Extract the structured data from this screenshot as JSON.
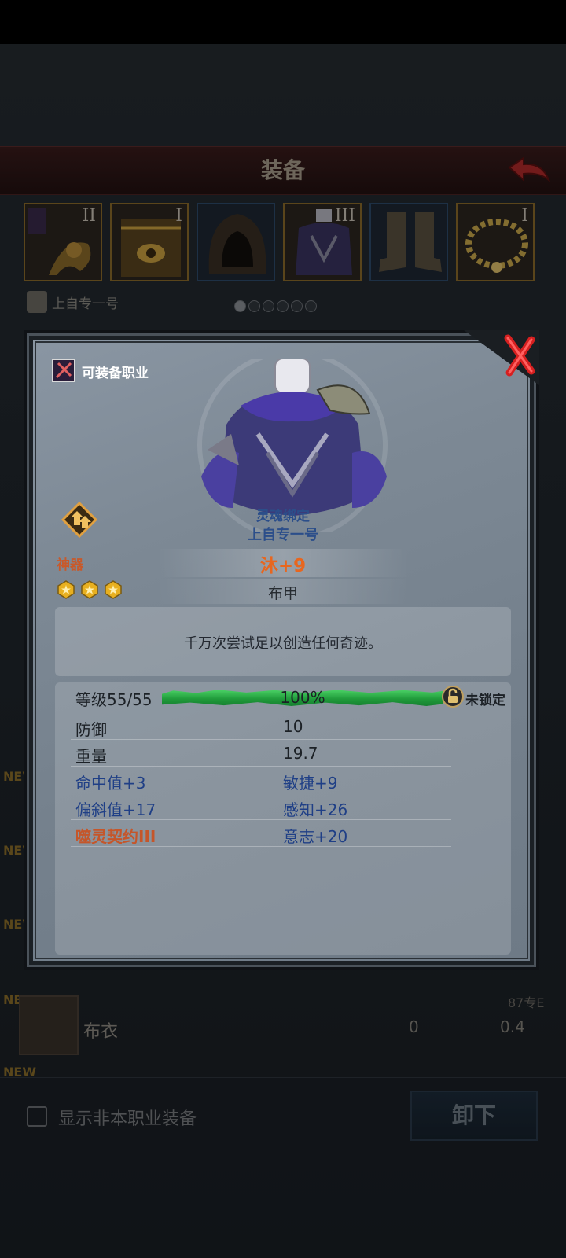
{
  "screen": {
    "title": "装备",
    "owner_name": "上自专一号",
    "slots": [
      {
        "roman": "II",
        "name": "dragon-staff"
      },
      {
        "roman": "I",
        "name": "tome"
      },
      {
        "roman": "",
        "name": "hood"
      },
      {
        "roman": "III",
        "name": "armor"
      },
      {
        "roman": "",
        "name": "boots"
      },
      {
        "roman": "I",
        "name": "necklace"
      }
    ],
    "page_dots_total": 6,
    "page_dots_active": 1,
    "list": {
      "new_tags": [
        "NEW",
        "NEW",
        "NEW",
        "NEW",
        "NEW"
      ],
      "row": {
        "name": "布衣",
        "value1": "0",
        "value2": "0.4",
        "tag": "87专E"
      }
    },
    "footer": {
      "checkbox_label": "显示非本职业装备",
      "unequip_label": "卸下"
    }
  },
  "modal": {
    "class_label": "可装备职业",
    "soulbound_label": "灵魂绑定",
    "soulbound_owner": "上自专一号",
    "artifact_label": "神器",
    "item_name": "沐+9",
    "stars": 3,
    "item_type": "布甲",
    "description": "千万次尝试足以创造任何奇迹。",
    "level_label": "等级55/55",
    "progress_percent": 100,
    "progress_text": "100%",
    "lock_label": "未锁定",
    "stats": [
      {
        "left": "防御",
        "right": "10"
      },
      {
        "left": "重量",
        "right": "19.7"
      },
      {
        "left": "命中值+3",
        "right": "敏捷+9"
      },
      {
        "left": "偏斜值+17",
        "right": "感知+26"
      },
      {
        "left": "噬灵契约III",
        "right": "意志+20"
      }
    ],
    "colors": {
      "artifact": "#c8592a",
      "item_name": "#e8661e",
      "soulbound": "#2b4e8a",
      "progress": "#2fb24a",
      "close": "#d62020"
    }
  }
}
